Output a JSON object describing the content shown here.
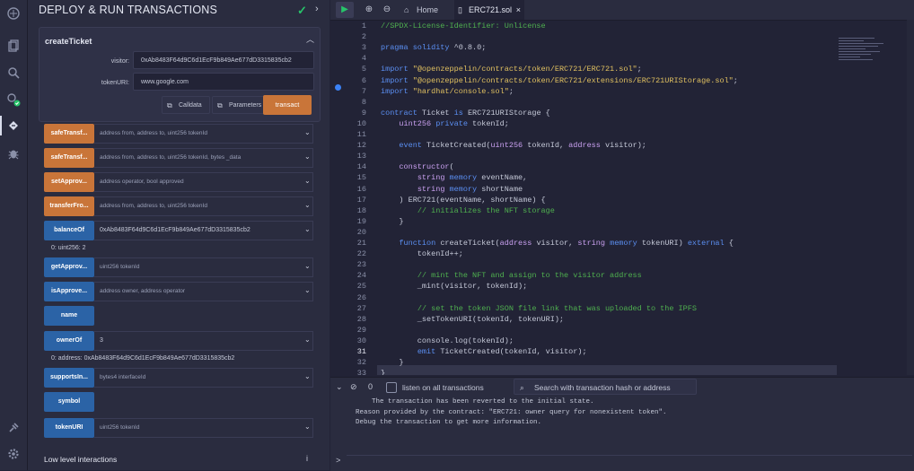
{
  "sidebar": {
    "icons": [
      "home-icon",
      "file-explorer-icon",
      "search-icon",
      "compiler-icon",
      "deploy-icon",
      "debugger-icon",
      "plugin-icon",
      "settings-icon"
    ]
  },
  "panel": {
    "title": "DEPLOY & RUN TRANSACTIONS",
    "create_ticket": {
      "title": "createTicket",
      "visitor_label": "visitor:",
      "visitor_value": "0xAb8483F64d9C6d1EcF9b849Ae677dD3315835cb2",
      "tokenuri_label": "tokenURI:",
      "tokenuri_value": "www.google.com",
      "calldata_label": "Calldata",
      "parameters_label": "Parameters",
      "transact_label": "transact"
    },
    "functions": [
      {
        "name": "safeTransf...",
        "args": "address from, address to, uint256 tokenId",
        "color": "orange"
      },
      {
        "name": "safeTransf...",
        "args": "address from, address to, uint256 tokenId, bytes _data",
        "color": "orange"
      },
      {
        "name": "setApprov...",
        "args": "address operator, bool approved",
        "color": "orange"
      },
      {
        "name": "transferFro...",
        "args": "address from, address to, uint256 tokenId",
        "color": "orange"
      },
      {
        "name": "balanceOf",
        "args": "0xAb8483F64d9C6d1EcF9b849Ae677dD3315835cb2",
        "color": "blue",
        "filled": true,
        "result": "0: uint256: 2"
      },
      {
        "name": "getApprov...",
        "args": "uint256 tokenId",
        "color": "blue"
      },
      {
        "name": "isApprove...",
        "args": "address owner, address operator",
        "color": "blue"
      },
      {
        "name": "name",
        "args": "",
        "color": "blue",
        "noarg": true
      },
      {
        "name": "ownerOf",
        "args": "3",
        "color": "blue",
        "filled": true,
        "result": "0: address: 0xAb8483F64d9C6d1EcF9b849Ae677dD3315835cb2"
      },
      {
        "name": "supportsIn...",
        "args": "bytes4 interfaceId",
        "color": "blue"
      },
      {
        "name": "symbol",
        "args": "",
        "color": "blue",
        "noarg": true
      },
      {
        "name": "tokenURI",
        "args": "uint256 tokenId",
        "color": "blue"
      }
    ],
    "low_level": "Low level interactions"
  },
  "editor": {
    "tabs": {
      "home": "Home",
      "file": "ERC721.sol"
    },
    "lines": [
      [
        [
          "c",
          "//SPDX-License-Identifier: Unlicense"
        ]
      ],
      [],
      [
        [
          "k",
          "pragma solidity "
        ],
        [
          "n",
          "^0.8.0;"
        ]
      ],
      [],
      [
        [
          "k",
          "import "
        ],
        [
          "s",
          "\"@openzeppelin/contracts/token/ERC721/ERC721.sol\""
        ],
        [
          "n",
          ";"
        ]
      ],
      [
        [
          "k",
          "import "
        ],
        [
          "s",
          "\"@openzeppelin/contracts/token/ERC721/extensions/ERC721URIStorage.sol\""
        ],
        [
          "n",
          ";"
        ]
      ],
      [
        [
          "k",
          "import "
        ],
        [
          "s",
          "\"hardhat/console.sol\""
        ],
        [
          "n",
          ";"
        ]
      ],
      [],
      [
        [
          "k",
          "contract "
        ],
        [
          "n",
          "Ticket "
        ],
        [
          "k",
          "is "
        ],
        [
          "n",
          "ERC721URIStorage {"
        ]
      ],
      [
        [
          "n",
          "    "
        ],
        [
          "t",
          "uint256 "
        ],
        [
          "k",
          "private "
        ],
        [
          "n",
          "tokenId;"
        ]
      ],
      [],
      [
        [
          "n",
          "    "
        ],
        [
          "k",
          "event "
        ],
        [
          "n",
          "TicketCreated("
        ],
        [
          "t",
          "uint256 "
        ],
        [
          "n",
          "tokenId, "
        ],
        [
          "t",
          "address "
        ],
        [
          "n",
          "visitor);"
        ]
      ],
      [],
      [
        [
          "n",
          "    "
        ],
        [
          "t",
          "constructor"
        ],
        [
          "n",
          "("
        ]
      ],
      [
        [
          "n",
          "        "
        ],
        [
          "t",
          "string "
        ],
        [
          "k",
          "memory "
        ],
        [
          "n",
          "eventName,"
        ]
      ],
      [
        [
          "n",
          "        "
        ],
        [
          "t",
          "string "
        ],
        [
          "k",
          "memory "
        ],
        [
          "n",
          "shortName"
        ]
      ],
      [
        [
          "n",
          "    ) ERC721(eventName, shortName) {"
        ]
      ],
      [
        [
          "n",
          "        "
        ],
        [
          "c",
          "// initializes the NFT storage"
        ]
      ],
      [
        [
          "n",
          "    }"
        ]
      ],
      [],
      [
        [
          "n",
          "    "
        ],
        [
          "k",
          "function "
        ],
        [
          "n",
          "createTicket("
        ],
        [
          "t",
          "address "
        ],
        [
          "n",
          "visitor, "
        ],
        [
          "t",
          "string "
        ],
        [
          "k",
          "memory "
        ],
        [
          "n",
          "tokenURI) "
        ],
        [
          "k",
          "external "
        ],
        [
          "n",
          "{"
        ]
      ],
      [
        [
          "n",
          "        tokenId++;"
        ]
      ],
      [],
      [
        [
          "n",
          "        "
        ],
        [
          "c",
          "// mint the NFT and assign to the visitor address"
        ]
      ],
      [
        [
          "n",
          "        _mint(visitor, tokenId);"
        ]
      ],
      [],
      [
        [
          "n",
          "        "
        ],
        [
          "c",
          "// set the token JSON file link that was uploaded to the IPFS"
        ]
      ],
      [
        [
          "n",
          "        _setTokenURI(tokenId, tokenURI);"
        ]
      ],
      [],
      [
        [
          "n",
          "        console.log(tokenId);"
        ]
      ],
      [
        [
          "n",
          "        "
        ],
        [
          "k",
          "emit "
        ],
        [
          "n",
          "TicketCreated(tokenId, visitor);"
        ]
      ],
      [
        [
          "n",
          "    }"
        ]
      ],
      [
        [
          "n",
          "}"
        ]
      ]
    ]
  },
  "terminal": {
    "count": "0",
    "listen_label": "listen on all transactions",
    "search_placeholder": "Search with transaction hash or address",
    "output": [
      "    The transaction has been reverted to the initial state.",
      "Reason provided by the contract: \"ERC721: owner query for nonexistent token\".",
      "Debug the transaction to get more information."
    ],
    "prompt": ">"
  }
}
